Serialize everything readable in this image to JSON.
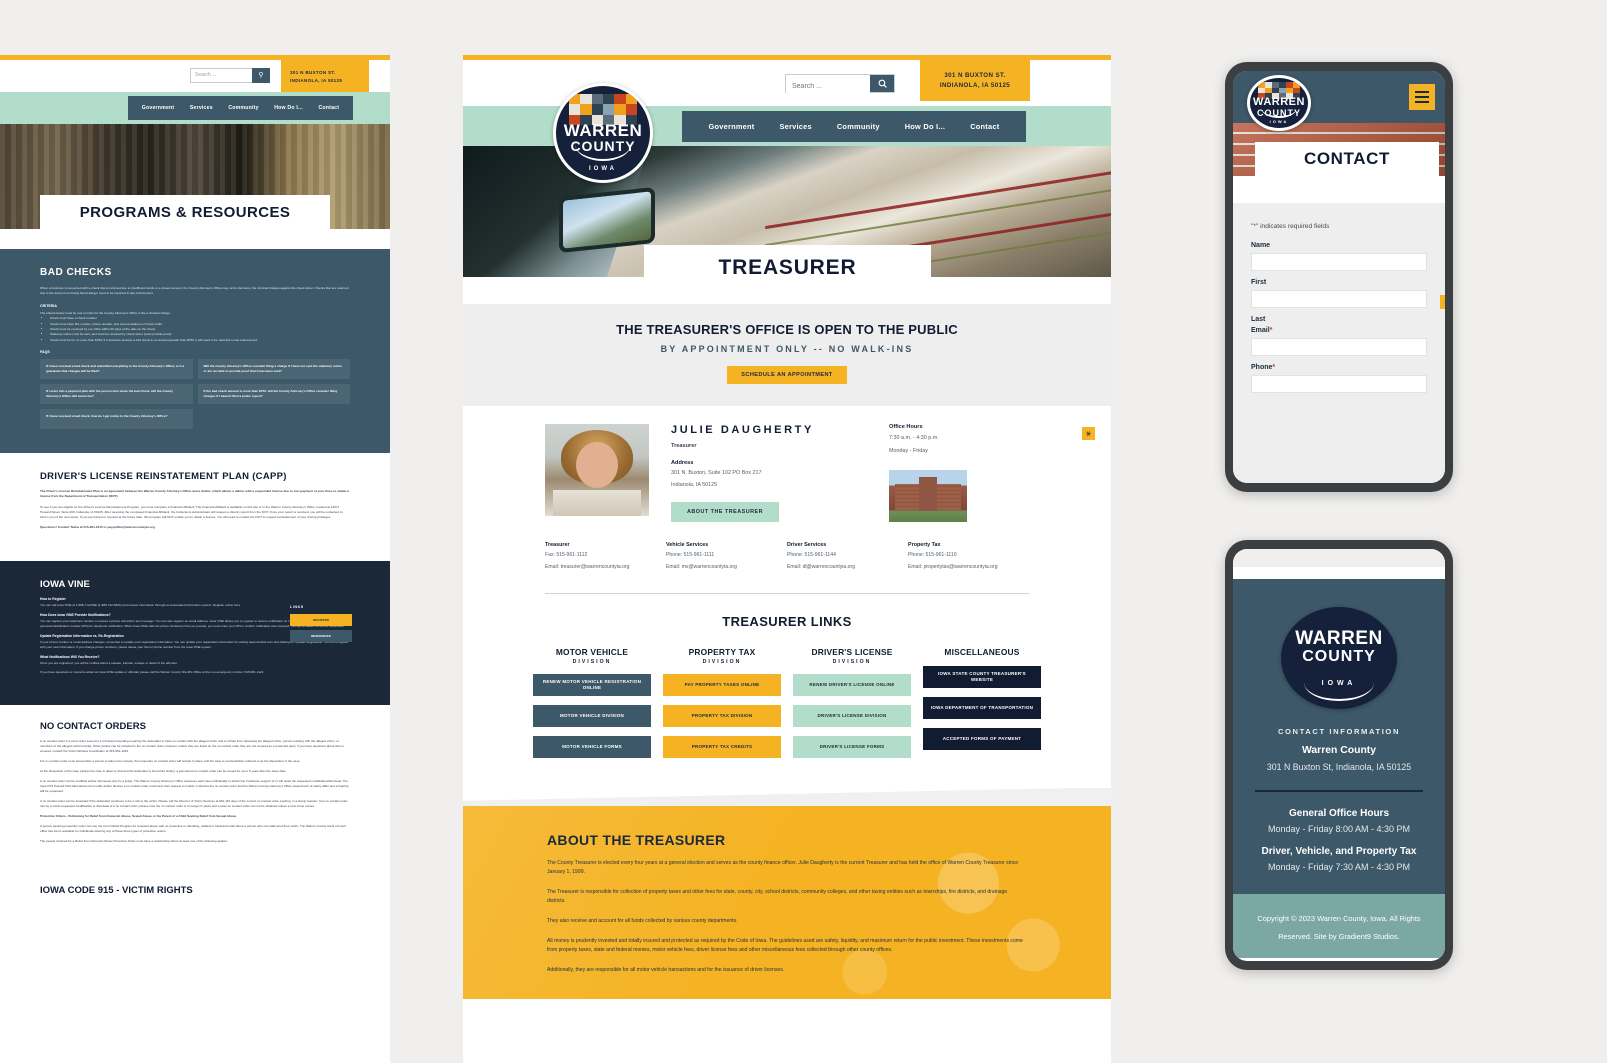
{
  "brand": {
    "logo_line1": "WARREN",
    "logo_line2": "COUNTY",
    "logo_sub": "IOWA",
    "colors": {
      "gold": "#f5b324",
      "slate": "#3d5868",
      "navy": "#111c33",
      "mint": "#b3ddcb",
      "teal_footer": "#7ba8a2"
    }
  },
  "desktop": {
    "utility": {
      "search_placeholder": "Search ...",
      "search_value": "",
      "search_icon": "search-icon",
      "address_line1": "301 N BUXTON ST.",
      "address_line2": "INDIANOLA, IA 50125"
    },
    "nav": [
      {
        "label": "Government"
      },
      {
        "label": "Services"
      },
      {
        "label": "Community"
      },
      {
        "label": "How Do I..."
      },
      {
        "label": "Contact"
      }
    ],
    "page_title": "TREASURER",
    "notice": {
      "heading": "THE TREASURER'S OFFICE IS OPEN TO THE PUBLIC",
      "subheading": "BY APPOINTMENT ONLY -- NO WALK-INS",
      "button": "SCHEDULE AN APPOINTMENT"
    },
    "accessibility_icon": "accessibility-icon",
    "profile": {
      "name": "JULIE DAUGHERTY",
      "role": "Treasurer",
      "address_label": "Address",
      "address_line1": "301 N. Buxton, Suite 102 PO Box 217",
      "address_line2": "Indianola, IA 50125",
      "about_button": "ABOUT THE TREASURER",
      "photo_alt": "treasurer-portrait"
    },
    "office_hours": {
      "label": "Office Hours",
      "time": "7:30 a.m. - 4:30 p.m.",
      "days": "Monday - Friday",
      "building_alt": "county-administration-building"
    },
    "contacts": [
      {
        "title": "Treasurer",
        "line1": "Fax: 515-961-1112",
        "line2": "Email: treasurer@warrencountyia.org"
      },
      {
        "title": "Vehicle Services",
        "line1": "Phone: 515-961-1111",
        "line2": "Email: mv@warrencountyia.org"
      },
      {
        "title": "Driver Services",
        "line1": "Phone: 515-961-1144",
        "line2": "Email: dl@warrencountyia.org"
      },
      {
        "title": "Property Tax",
        "line1": "Phone: 515-961-1110",
        "line2": "Email: propertytax@warrencountyia.org"
      }
    ],
    "links_section": {
      "heading": "TREASURER LINKS",
      "columns": [
        {
          "title": "MOTOR VEHICLE",
          "subtitle": "DIVISION",
          "style": "slate",
          "buttons": [
            "RENEW MOTOR VEHICLE REGISTRATION ONLINE",
            "MOTOR VEHICLE DIVISION",
            "MOTOR VEHICLE FORMS"
          ]
        },
        {
          "title": "PROPERTY TAX",
          "subtitle": "DIVISION",
          "style": "gold",
          "buttons": [
            "PAY PROPERTY TAXES ONLINE",
            "PROPERTY TAX DIVISION",
            "PROPERTY TAX CREDITS"
          ]
        },
        {
          "title": "DRIVER'S LICENSE",
          "subtitle": "DIVISION",
          "style": "mint",
          "buttons": [
            "RENEW DRIVER'S LICENSE ONLINE",
            "DRIVER'S LICENSE DIVISION",
            "DRIVER'S LICENSE FORMS"
          ]
        },
        {
          "title": "MISCELLANEOUS",
          "subtitle": "",
          "style": "navy",
          "buttons": [
            "IOWA STATE COUNTY TREASURER'S WEBSITE",
            "IOWA DEPARTMENT OF TRANSPORTATION",
            "ACCEPTED FORMS OF PAYMENT"
          ]
        }
      ]
    },
    "about": {
      "heading": "ABOUT THE TREASURER",
      "p1": "The County Treasurer is elected every four years at a general election and serves as the county finance officer. Julie Daugherty is the current Treasurer and has held the office of Warren County Treasurer since January 1, 1999.",
      "p2": "The Treasurer is responsible for collection of property taxes and other fees for state, county, city, school districts, community colleges, and other taxing entities such as townships, fire districts, and drainage districts.",
      "p3": "They also receive and account for all funds collected by various county departments.",
      "p4": "All money is prudently invested and totally insured and protected as required by the Code of Iowa. The guidelines used are safety, liquidity, and maximum return for the public investment. These investments come from property taxes, state and federal monies, motor vehicle fees, driver license fees and other miscellaneous fees collected through other county offices.",
      "p5": "Additionally, they are responsible for all motor vehicle transactions and for the issuance of driver licenses."
    }
  },
  "left_page": {
    "utility": {
      "search_placeholder": "Search ...",
      "address_line1": "301 N BUXTON ST.",
      "address_line2": "INDIANOLA, IA 50125"
    },
    "nav": [
      "Government",
      "Services",
      "Community",
      "How Do I...",
      "Contact"
    ],
    "page_title": "PROGRAMS & RESOURCES",
    "sections": [
      {
        "heading": "BAD CHECKS",
        "intro": "When a business is presented with a check that is returned due to insufficient funds or a closed account, the County Attorney's Office may, at its discretion, file criminal charges against the check writer. Checks that are returned due to the account not being found always need to be reported to law enforcement.",
        "criteria_label": "CRITERIA",
        "criteria_note": "The criteria below must be met in order for the County Attorney's Office to file a criminal charge:",
        "criteria": [
          "Check must have a check number",
          "Check must have IDL number, phone number, and current address of check writer",
          "Check must be received by our office within 60 days of the date on the check",
          "Statutory notice must be sent, and must be received by check writer (must provide proof)",
          "Check must be for no more than $750; if a business accepts a bad check in an amount greater than $750, it will need to be reported to law enforcement"
        ],
        "faq_label": "FAQS",
        "faqs": [
          "If I have received a bad check and submitted everything to the County Attorney's Office, is it a guarantee that charges will be filed?",
          "Will the County Attorney's Office consider filing a charge if I have not sent the statutory notice or am not able to provide proof that it has been sent?",
          "If I enter into a payment plan with the person who wrote the bad check, will the County Attorney's Office still assist me?",
          "If the bad check amount is more than $750, will the County Attorney's Office consider filing charges if I haven't filed a police report?",
          "If I have received a bad check, how do I get notice to the County Attorney's Office?"
        ]
      },
      {
        "heading": "DRIVER'S LICENSE REINSTATEMENT PLAN (CAPP)",
        "p_bold": "The Driver's License Reinstatement Plan is an agreement between the Warren County Attorney's Office and a debtor, which allows a debtor with a suspended license due to non-payment of your fines to obtain a license from the Department of Transportation (DOT).",
        "p1": "To see if you are eligible for the Driver's License Reinstatement Program, you must complete a Financial Affidavit. The Financial Affidavit is available on this site or in the Warren County Attorney's Office, located at 115 N Howard Street, Suite 200, Indianola, IA 50125. After receiving the completed Financial Affidavit, the Collections Administrator will request a directly report from the DOT. Once your report is received, you will be contacted to inform you of the next steps. If you are barred or revoked at the future date, this program will NOT enable you to obtain a license. You will need to contact the DOT to request reinstatement of your driving privileges.",
        "p2": "Questions? Contact Tasha at 515-961-1015 or paypoffice@warrencountyia.org"
      },
      {
        "heading": "IOWA VINE",
        "sub1": "How to Register",
        "b1": "You can call Iowa VINE at 1-888-7-IAVINE (1-888-742-8463) and receive information through an automated information system. Register online here.",
        "sub2": "How Does Iowa VINE Provide Notifications?",
        "b2": "You can register your telephone number to receive a phone call and/or text message. You can also register an email address. Iowa VINE allows you to register to receive notification on multiple phone numbers. You will choose a personal identification number (PIN) for telephone notification. When Iowa VINE calls the phone number(s) that you provide, you must enter your PIN to confirm notification was received. You will be asked to confirm notification.",
        "sub3": "Update Registration Information vs. Re-Registration",
        "b3": "If your phone number or email address changes, remember to update your registration information. You can update your registration information by visiting www.vinelink.com and clicking on 'Update Registration'. Do not re-register with your new information. If you change phone numbers, please delete your former phone number from the Iowa VINE system.",
        "sub4": "What Notifications Will You Receive?",
        "b4": "Once you are registered, you will be notified about a release, transfer, escape or death of the offender.",
        "sub5": "If you have questions or concerns about an Iowa VINE update or offender please call the Warren County Sheriff's Office at the non-emergency number: 515-961-1122",
        "links_title": "LINKS",
        "link_buttons": [
          "REGISTER",
          "RESOURCES"
        ]
      },
      {
        "heading": "NO CONTACT ORDERS",
        "p1": "A no contact order is a court order issued in a criminal proceeding requiring the defendant to have no contact with the alleged victim and to refrain from harassing the alleged victim, person residing with the alleged victim, or members of the alleged victim's family. Other parties can be included in the no contact order, however, unless they are listed on the no contact order they are not covered as a protected party. If you have questions about who is covered, contact the Victim Witness Coordinator at 515-961-1015.",
        "p2": "For no contact order to be issued after a person is taken into custody, the temporary no contact order will remain in place until the case is resolved/often referred to as the disposition of the case.",
        "p3": "At the disposition of the case (unless the case is taken to trial and the defendant is found Not Guilty), a permanent no contact order can be issued for up to 5 years after the issue date.",
        "p4": "A no contact order can be modified and/or dismissed only by a judge. The Warren County Attorney's Office assesses each case individually to determine if advance support of or will resist the requested modification/dismissal. The Iowa ICIS Passed Pilot Alternatives Act modify and/or dismiss a no contact order must have their request to modify or dismiss the no contact order and the Warren County Attorney's Office assessment of safety differ and a hearing will be requested.",
        "p5": "A no contact order can be amended if the defendant continues to be a risk to the victim. Please call the Director of Victim Services at 961-116 days of the current no contact order expiring, in a timely manner. Your no contact order can be a victim-requested modification or dismissal of a no contact order; please note the no contact order is no longer in place and a case no contact order can not be obtained unless a new crime occurs.",
        "p_bold": "Protective Orders - Petitioning for Relief from Domestic Abuse, Sexual Abuse or the Parent of a Child Seeking Relief from Sexual Abuse",
        "p6": "A person desiring protection order can use the Court Relief Program for renewed abuse with no protective or offending, stalked or harassed relief about a person who can stalk all of their victim. The Warren County Clerk of Court office has forms available for individuals desiring any of these three types of protective orders.",
        "p7": "The people involved for a Relief from Domestic Abuse Protective Order must have a relationship where at least one of the following applies:"
      },
      {
        "heading": "IOWA CODE 915 - VICTIM RIGHTS"
      }
    ]
  },
  "phone_contact": {
    "logo_line1": "WARREN",
    "logo_line2": "COUNTY",
    "logo_sub": "IOWA",
    "menu_icon": "hamburger-menu-icon",
    "page_title": "CONTACT",
    "required_note": "\"*\" indicates required fields",
    "accessibility_icon": "accessibility-icon",
    "fields": [
      {
        "label": "Name",
        "required": false,
        "value": ""
      },
      {
        "label": "First",
        "required": false,
        "value": ""
      },
      {
        "label": "Last",
        "required": false,
        "value": ""
      },
      {
        "label": "Email",
        "required": true,
        "value": ""
      },
      {
        "label": "Phone",
        "required": true,
        "value": ""
      }
    ]
  },
  "phone_footer": {
    "logo_line1": "WARREN",
    "logo_line2": "COUNTY",
    "logo_sub": "IOWA",
    "contact_heading": "CONTACT INFORMATION",
    "org_name": "Warren County",
    "address": "301 N Buxton St, Indianola, IA 50125",
    "hours": [
      {
        "label": "General Office Hours",
        "value": "Monday - Friday 8:00 AM - 4:30 PM"
      },
      {
        "label": "Driver, Vehicle, and Property Tax",
        "value": "Monday - Friday 7:30 AM - 4:30 PM"
      }
    ],
    "copyright": "Copyright © 2023 Warren County, Iowa. All Rights Reserved. Site by Gradient9 Studios."
  }
}
